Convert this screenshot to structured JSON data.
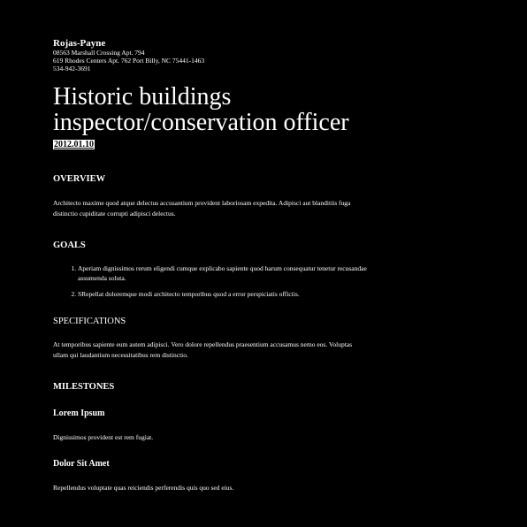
{
  "header": {
    "company": "Rojas-Payne",
    "address_line1": "08563 Marshall Crossing Apt. 794",
    "address_line2": "619 Rhodes Centers Apt. 762 Port Billy, NC 75441-1463",
    "phone": "534-942-3691"
  },
  "document": {
    "title": "Historic buildings inspector/conservation officer",
    "date": "2012.01.10"
  },
  "overview": {
    "heading": "OVERVIEW",
    "text": "Architecto maxime quod atque delectus accusantium provident laboriosam expedita. Adipisci aut blanditiis fuga distinctio cupiditate corrupti adipisci delectus."
  },
  "goals": {
    "heading": "GOALS",
    "items": [
      "Aperiam dignissimos rerum eligendi cumque explicabo sapiente quod harum consequatur tenetur recusandae assumenda soluta.",
      "SRepellat doloremque modi architecto temporibus quod a error perspiciatis officiis."
    ]
  },
  "specifications": {
    "heading": "SPECIFICATIONS",
    "text": "At temporibus sapiente eum autem adipisci. Vero dolore repellendus praesentium accusamus nemo eos. Voluptas ullam qui laudantium necessitatibus rem distinctio."
  },
  "milestones": {
    "heading": "MILESTONES",
    "items": [
      {
        "title": "Lorem Ipsum",
        "text": "Dignissimos provident est rem fugiat."
      },
      {
        "title": "Dolor Sit Amet",
        "text": "Repellendus voluptate quas reiciendis perferendis quis quo sed eius."
      }
    ]
  },
  "colors": {
    "background": "#000000",
    "text": "#ffffff"
  }
}
